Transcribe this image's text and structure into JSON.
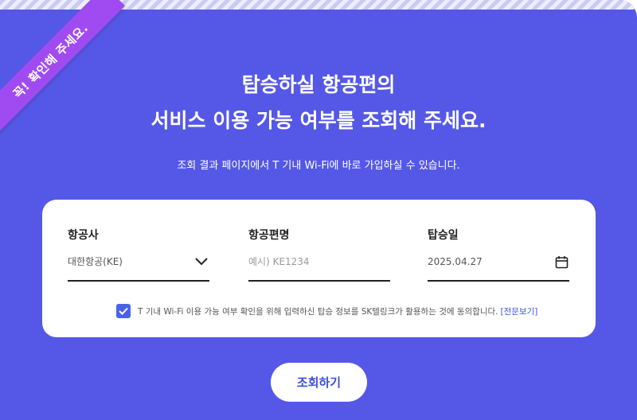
{
  "ribbon": {
    "label": "꼭! 확인해 주세요."
  },
  "header": {
    "title_line1": "탑승하실 항공편의",
    "title_line2": "서비스 이용 가능 여부를 조회해 주세요.",
    "subtitle": "조회 결과 페이지에서 T 기내 Wi-Fi에 바로 가입하실 수 있습니다."
  },
  "form": {
    "airline": {
      "label": "항공사",
      "value": "대한항공(KE)",
      "icon": "chevron-down-icon"
    },
    "flight": {
      "label": "항공편명",
      "placeholder": "예시) KE1234"
    },
    "date": {
      "label": "탑승일",
      "value": "2025.04.27",
      "icon": "calendar-icon"
    },
    "consent": {
      "checked": true,
      "text": "T 기내 Wi-Fi 이용 가능 여부 확인을 위해 입력하신 탑승 정보를 SK텔링크가 활용하는 것에 동의합니다.",
      "link": "[전문보기]"
    }
  },
  "actions": {
    "search_label": "조회하기"
  },
  "colors": {
    "background": "#5558e6",
    "ribbon": "#a04bf2",
    "accent": "#3b4fe0",
    "checkbox": "#4a63e6"
  }
}
